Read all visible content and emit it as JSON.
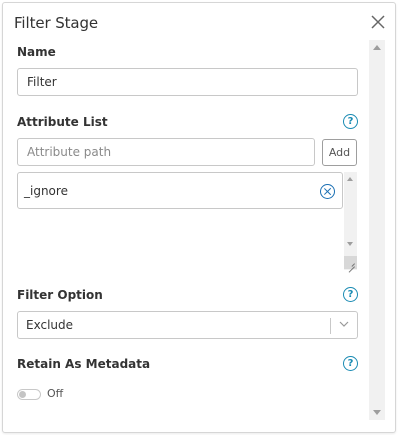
{
  "dialog": {
    "title": "Filter Stage"
  },
  "name_field": {
    "label": "Name",
    "value": "Filter"
  },
  "attribute_list": {
    "label": "Attribute List",
    "help": "?",
    "placeholder": "Attribute path",
    "add_label": "Add",
    "items": [
      {
        "value": "_ignore"
      }
    ]
  },
  "filter_option": {
    "label": "Filter Option",
    "help": "?",
    "selected": "Exclude"
  },
  "retain_metadata": {
    "label": "Retain As Metadata",
    "help": "?",
    "state": "Off"
  },
  "colors": {
    "accent": "#1a8bb3",
    "border": "#c8c8c8",
    "scrollbar": "#f1f1f1"
  }
}
